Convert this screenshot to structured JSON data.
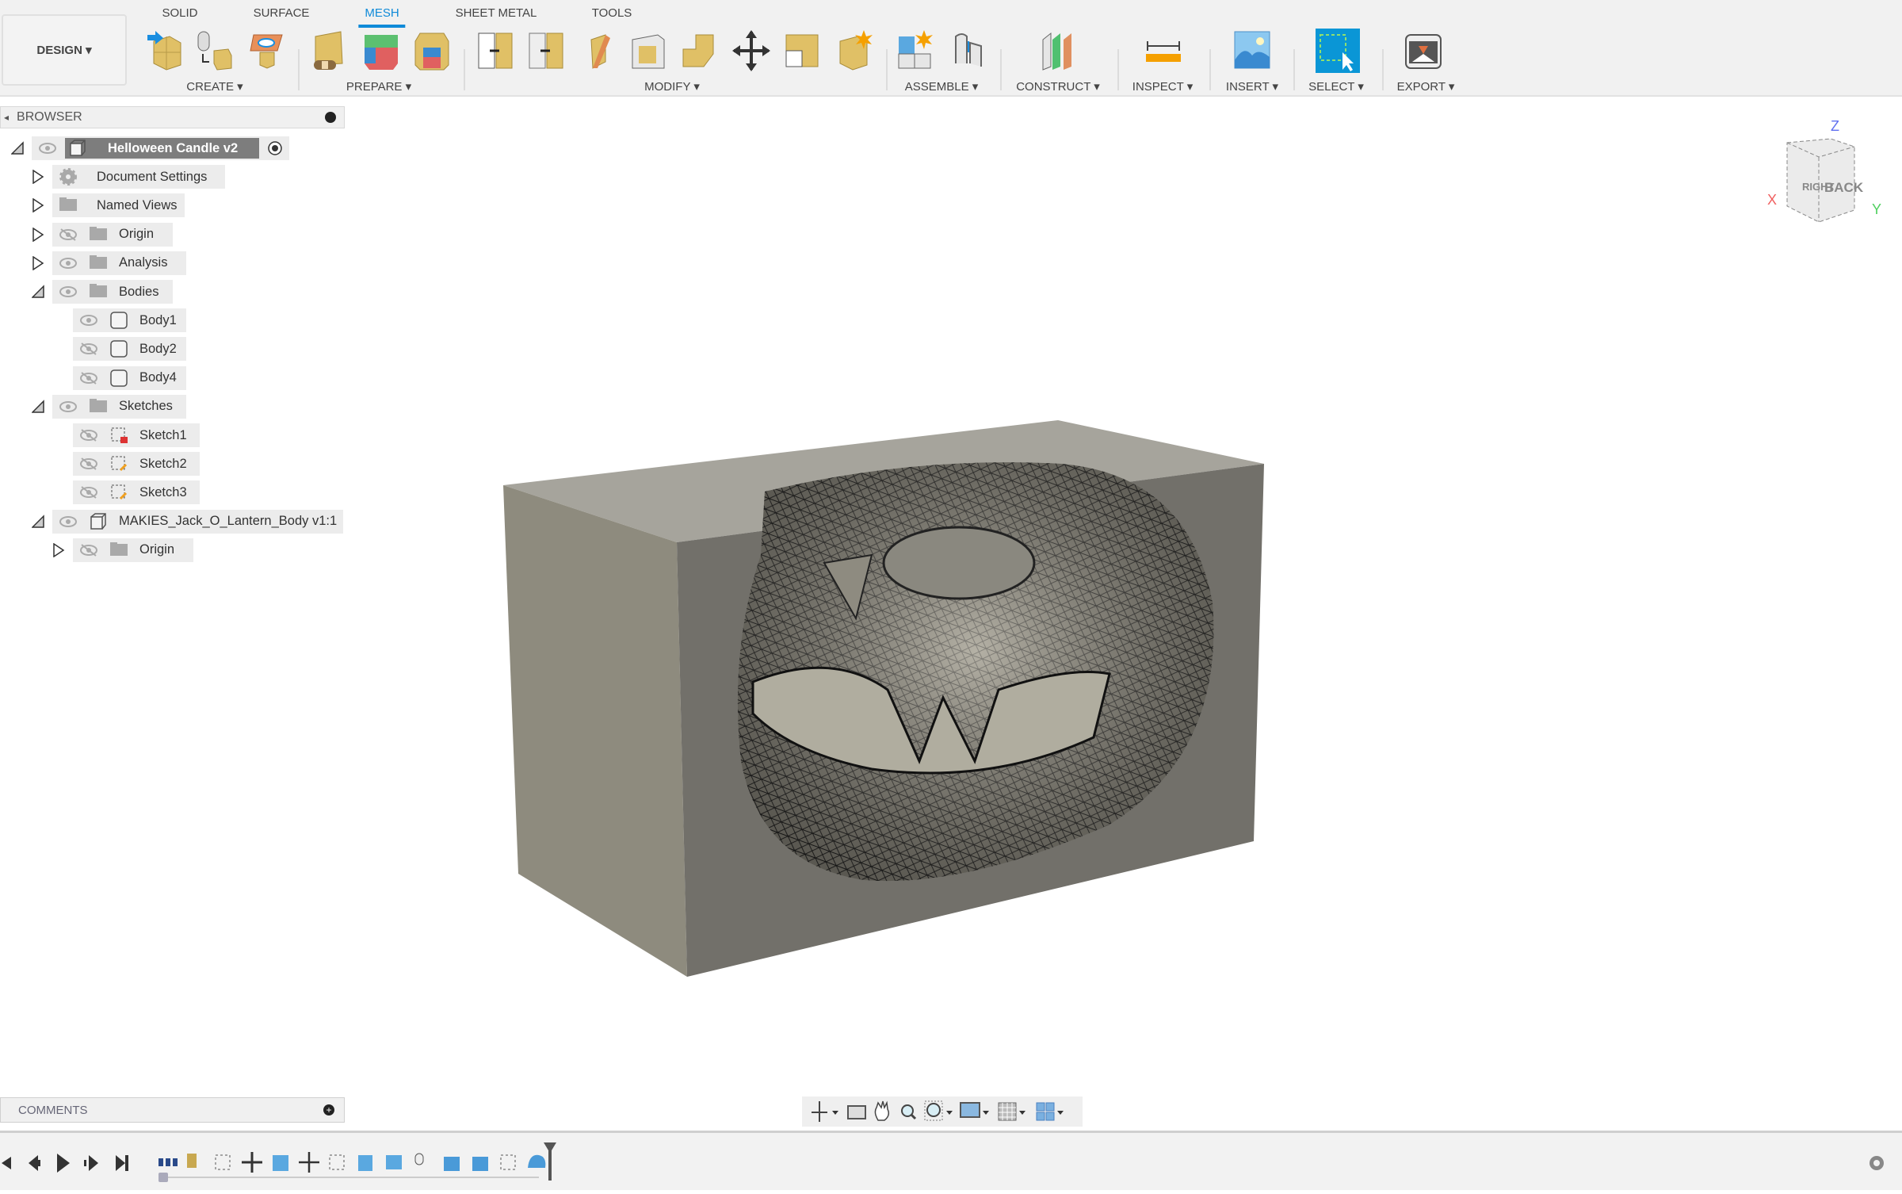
{
  "workspace": {
    "label": "DESIGN"
  },
  "tabs": [
    {
      "label": "SOLID",
      "active": false
    },
    {
      "label": "SURFACE",
      "active": false
    },
    {
      "label": "MESH",
      "active": true
    },
    {
      "label": "SHEET METAL",
      "active": false
    },
    {
      "label": "TOOLS",
      "active": false
    }
  ],
  "groups": [
    {
      "label": "CREATE"
    },
    {
      "label": "PREPARE"
    },
    {
      "label": "MODIFY"
    },
    {
      "label": "ASSEMBLE"
    },
    {
      "label": "CONSTRUCT"
    },
    {
      "label": "INSPECT"
    },
    {
      "label": "INSERT"
    },
    {
      "label": "SELECT"
    },
    {
      "label": "EXPORT"
    }
  ],
  "browser": {
    "title": "BROWSER",
    "items": [
      {
        "label": "Helloween Candle v2",
        "level": 0,
        "expander": "open",
        "eye": "visible",
        "icon": "component-icon",
        "root": true
      },
      {
        "label": "Document Settings",
        "level": 1,
        "expander": "closed",
        "eye": "none",
        "icon": "gear-icon"
      },
      {
        "label": "Named Views",
        "level": 1,
        "expander": "closed",
        "eye": "none",
        "icon": "folder-icon"
      },
      {
        "label": "Origin",
        "level": 1,
        "expander": "closed",
        "eye": "hidden",
        "icon": "folder-icon"
      },
      {
        "label": "Analysis",
        "level": 1,
        "expander": "closed",
        "eye": "visible",
        "icon": "folder-icon"
      },
      {
        "label": "Bodies",
        "level": 1,
        "expander": "open",
        "eye": "visible",
        "icon": "folder-icon"
      },
      {
        "label": "Body1",
        "level": 2,
        "expander": "none",
        "eye": "visible",
        "icon": "body-icon"
      },
      {
        "label": "Body2",
        "level": 2,
        "expander": "none",
        "eye": "hidden",
        "icon": "body-icon"
      },
      {
        "label": "Body4",
        "level": 2,
        "expander": "none",
        "eye": "hidden",
        "icon": "body-icon"
      },
      {
        "label": "Sketches",
        "level": 1,
        "expander": "open",
        "eye": "visible",
        "icon": "folder-icon"
      },
      {
        "label": "Sketch1",
        "level": 2,
        "expander": "none",
        "eye": "hidden",
        "icon": "sketch-locked-icon"
      },
      {
        "label": "Sketch2",
        "level": 2,
        "expander": "none",
        "eye": "hidden",
        "icon": "sketch-icon"
      },
      {
        "label": "Sketch3",
        "level": 2,
        "expander": "none",
        "eye": "hidden",
        "icon": "sketch-icon"
      },
      {
        "label": "MAKIES_Jack_O_Lantern_Body v1:1",
        "level": 1,
        "expander": "open",
        "eye": "visible",
        "icon": "component-icon"
      },
      {
        "label": "Origin",
        "level": 2,
        "expander": "closed",
        "eye": "hidden",
        "icon": "folder-icon"
      }
    ]
  },
  "comments": {
    "title": "COMMENTS"
  },
  "viewcube": {
    "right": "RIGHT",
    "back": "BACK",
    "x": "X",
    "y": "Y",
    "z": "Z"
  },
  "colors": {
    "accent": "#0f8ad8",
    "select_bg": "#0a96d6",
    "body": "#8a8880",
    "tool_gold": "#e0c066"
  }
}
